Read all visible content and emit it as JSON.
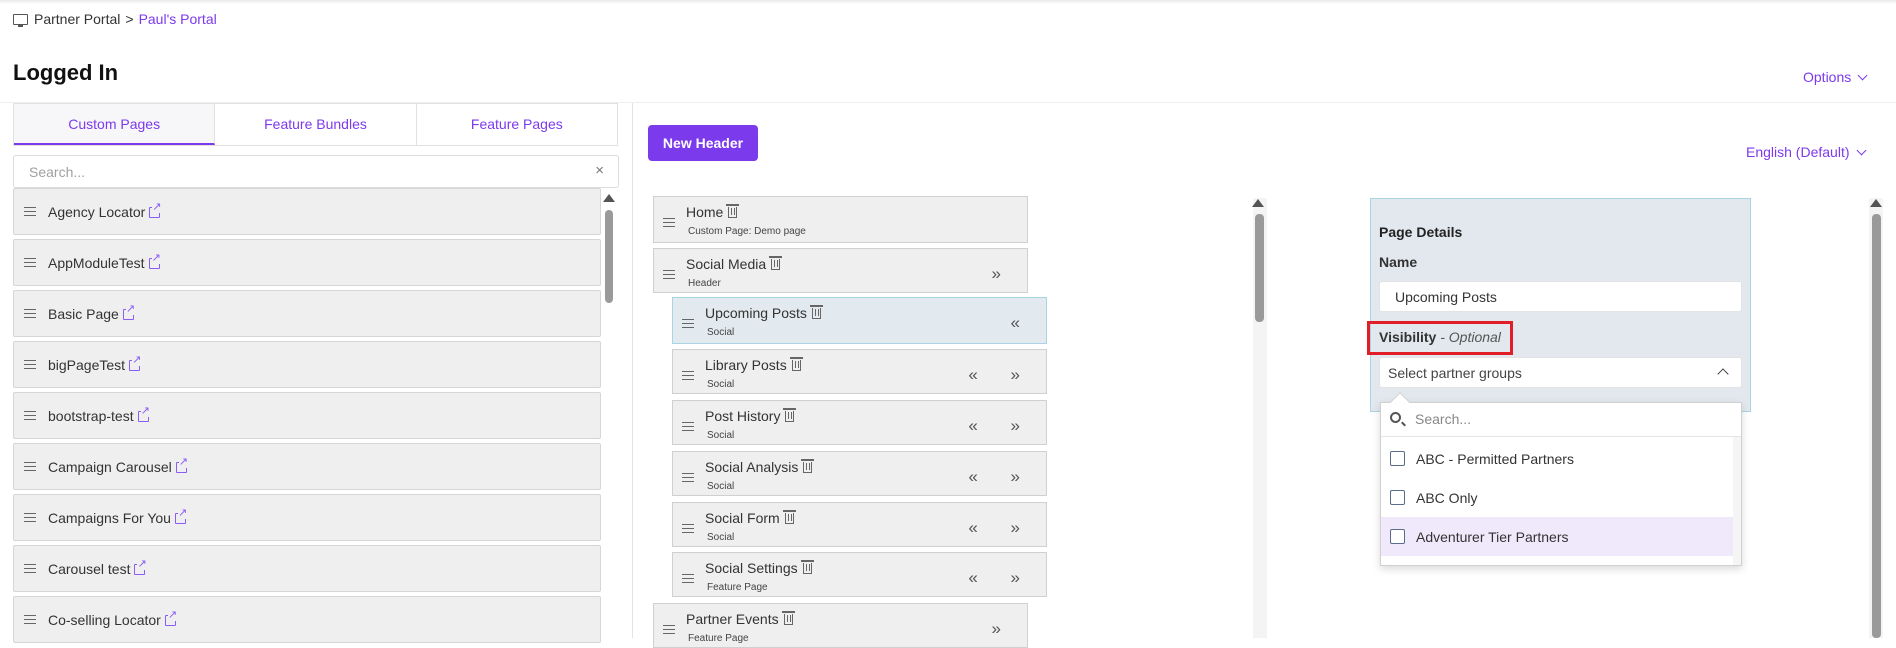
{
  "breadcrumb": {
    "root": "Partner Portal",
    "separator": ">",
    "current": "Paul's Portal"
  },
  "page": {
    "title": "Logged In",
    "options_label": "Options"
  },
  "left_tabs": [
    {
      "label": "Custom Pages",
      "active": true
    },
    {
      "label": "Feature Bundles",
      "active": false
    },
    {
      "label": "Feature Pages",
      "active": false
    }
  ],
  "left_search": {
    "placeholder": "Search...",
    "clear": "×"
  },
  "custom_pages": [
    {
      "label": "Agency Locator"
    },
    {
      "label": "AppModuleTest"
    },
    {
      "label": "Basic Page"
    },
    {
      "label": "bigPageTest"
    },
    {
      "label": "bootstrap-test"
    },
    {
      "label": "Campaign Carousel"
    },
    {
      "label": "Campaigns For You"
    },
    {
      "label": "Carousel test"
    },
    {
      "label": "Co-selling Locator"
    }
  ],
  "new_header_label": "New Header",
  "language_label": "English (Default)",
  "tree": [
    {
      "name": "Home",
      "sub": "Custom Page: Demo page",
      "arrows": ""
    },
    {
      "name": "Social Media",
      "sub": "Header",
      "arrows": "»"
    },
    {
      "name": "Upcoming Posts",
      "sub": "Social",
      "arrows": "«"
    },
    {
      "name": "Library Posts",
      "sub": "Social",
      "arrows": "« »"
    },
    {
      "name": "Post History",
      "sub": "Social",
      "arrows": "« »"
    },
    {
      "name": "Social Analysis",
      "sub": "Social",
      "arrows": "« »"
    },
    {
      "name": "Social Form",
      "sub": "Social",
      "arrows": "« »"
    },
    {
      "name": "Social Settings",
      "sub": "Feature Page",
      "arrows": "« »"
    },
    {
      "name": "Partner Events",
      "sub": "Feature Page",
      "arrows": "»"
    }
  ],
  "details": {
    "title": "Page Details",
    "name_label": "Name",
    "name_value": "Upcoming Posts",
    "visibility_label": "Visibility",
    "visibility_suffix": "- Optional",
    "select_placeholder": "Select partner groups"
  },
  "dropdown": {
    "search_placeholder": "Search...",
    "options": [
      {
        "label": "ABC - Permitted Partners",
        "checked": false
      },
      {
        "label": "ABC Only",
        "checked": false
      },
      {
        "label": "Adventurer Tier Partners",
        "checked": false
      }
    ]
  },
  "colors": {
    "accent": "#7c3aed",
    "highlight_box": "#e11d27",
    "selected_row": "#e2eaef"
  }
}
